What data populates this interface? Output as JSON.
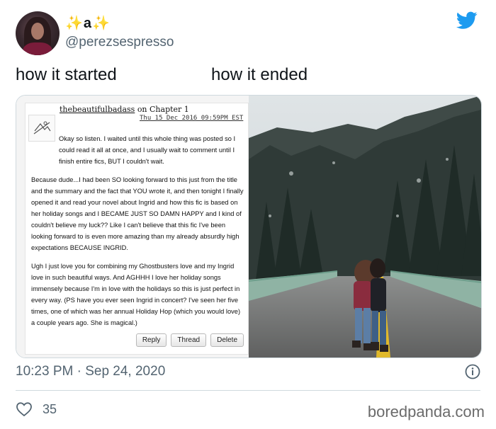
{
  "user": {
    "display_name": "a",
    "handle": "@perezsespresso"
  },
  "tweet": {
    "text_left": "how it started",
    "text_right": "how it ended"
  },
  "screenshot": {
    "username": "thebeautifulbadass",
    "on_label": "on Chapter 1",
    "date": "Thu 15 Dec 2016 09:59PM EST",
    "paragraphs": [
      "Okay so listen. I waited until this whole thing was posted so I could read it all at once, and I usually wait to comment until I finish entire fics, BUT I couldn't wait.",
      "Because dude...I had been SO looking forward to this just from the title and the summary and the fact that YOU wrote it, and then tonight I finally opened it and read your novel about Ingrid and how this fic is based on her holiday songs and I BECAME JUST SO DAMN HAPPY and I kind of couldn't believe my luck?? Like I can't believe that this fic I've been looking forward to is even more amazing than my already absurdly high expectations BECAUSE INGRID.",
      "Ugh I just love you for combining my Ghostbusters love and my Ingrid love in such beautiful ways. And AGHHH I love her holiday songs immensely because I'm in love with the holidays so this is just perfect in every way. (PS have you ever seen Ingrid in concert? I've seen her five times, one of which was her annual Holiday Hop (which you would love) a couple years ago. She is magical.)"
    ],
    "buttons": {
      "reply": "Reply",
      "thread": "Thread",
      "delete": "Delete"
    }
  },
  "meta": {
    "timestamp": "10:23 PM · Sep 24, 2020",
    "likes": "35",
    "watermark": "boredpanda.com"
  },
  "colors": {
    "twitter_blue": "#1d9bf0",
    "secondary_text": "#536471",
    "sparkle": "#f4b400"
  },
  "icons": [
    "twitter-bird-icon",
    "sparkles-icon",
    "info-icon",
    "heart-icon"
  ]
}
